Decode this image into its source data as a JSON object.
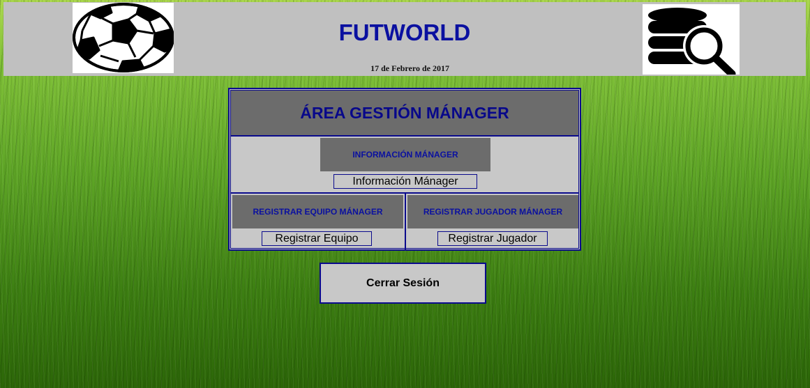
{
  "header": {
    "title": "FUTWORLD",
    "date": "17 de Febrero de 2017",
    "left_logo_icon": "soccer-ball-icon",
    "right_logo_icon": "database-search-icon"
  },
  "panel": {
    "title": "ÁREA GESTIÓN MÁNAGER",
    "info": {
      "heading": "INFORMACIÓN MÁNAGER",
      "button_label": "Información Mánager"
    },
    "team": {
      "heading": "REGISTRAR EQUIPO MÁNAGER",
      "button_label": "Registrar Equipo"
    },
    "player": {
      "heading": "REGISTRAR JUGADOR MÁNAGER",
      "button_label": "Registrar Jugador"
    }
  },
  "logout_label": "Cerrar Sesión",
  "colors": {
    "header_bg": "#c0c0c0",
    "title_blue": "#0a10a0",
    "border_navy": "#0a0a8c",
    "section_gray": "#6c6c6c",
    "cell_gray": "#c8c8c8"
  }
}
